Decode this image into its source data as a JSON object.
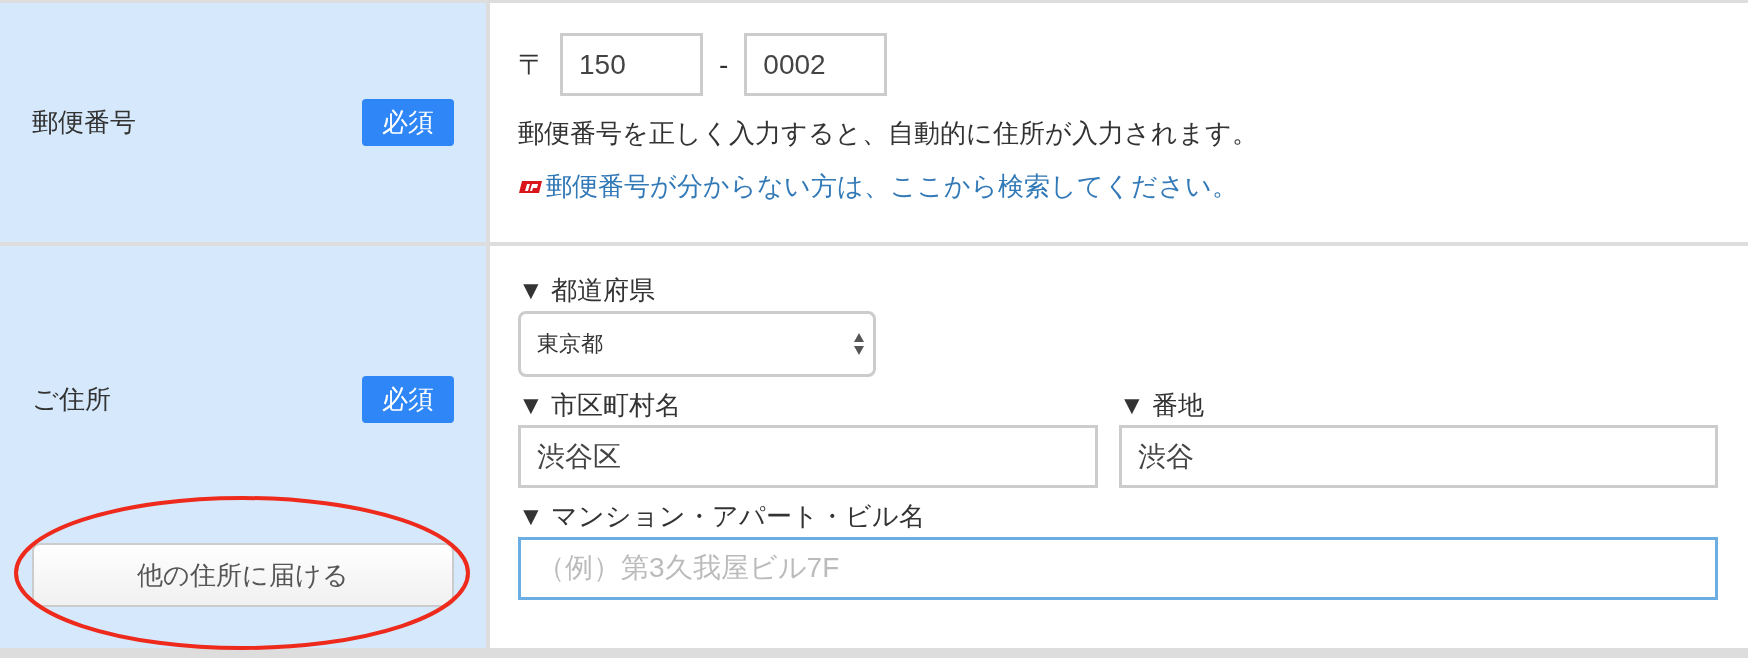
{
  "postal_row": {
    "label": "郵便番号",
    "badge": "必須",
    "postal_mark": "〒",
    "first_part": "150",
    "separator": "-",
    "second_part": "0002",
    "note": "郵便番号を正しく入力すると、自動的に住所が入力されます。",
    "link": "郵便番号が分からない方は、ここから検索してください。"
  },
  "address_row": {
    "label": "ご住所",
    "badge": "必須",
    "fields": [
      {
        "kind": "select",
        "label": "▼ 都道府県",
        "value": "東京都"
      },
      {
        "kind": "text",
        "label": "▼ 市区町村名",
        "value": "渋谷区"
      },
      {
        "kind": "text",
        "label": "▼ 番地",
        "value": "渋谷"
      },
      {
        "kind": "text",
        "label": "▼ マンション・アパート・ビル名",
        "placeholder": "（例）第3久我屋ビル7F",
        "focused": true
      }
    ],
    "button": {
      "label": "他の住所に届ける",
      "highlighted": true
    }
  }
}
